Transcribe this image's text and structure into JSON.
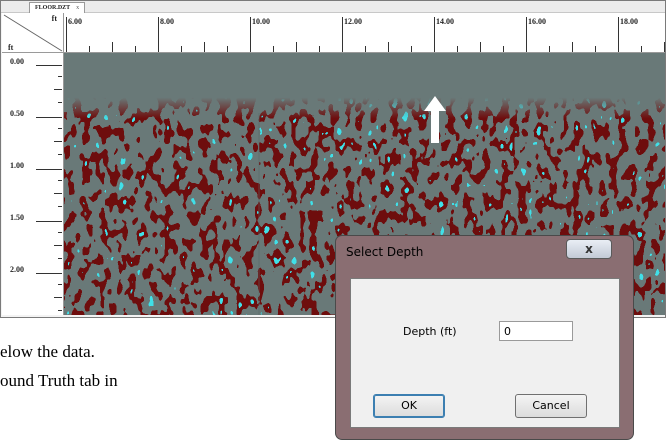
{
  "viewer": {
    "tab_label": "FLOOR.DZT",
    "tab_close_glyph": "x",
    "x_unit": "ft",
    "y_unit": "ft",
    "x_ticks": [
      "6.00",
      "8.00",
      "10.00",
      "12.00",
      "14.00",
      "16.00",
      "18.00"
    ],
    "y_ticks": [
      "0.00",
      "0.50",
      "1.00",
      "1.50",
      "2.00"
    ],
    "marker_icon": "up-arrow-icon"
  },
  "document": {
    "line1": "elow the data.",
    "line2": "ound Truth tab in"
  },
  "dialog": {
    "title": "Select Depth",
    "close_glyph": "x",
    "depth_label": "Depth  (ft)",
    "depth_value": "0",
    "ok_label": "OK",
    "cancel_label": "Cancel"
  },
  "colors": {
    "radar_background": "#697978",
    "radar_positive": "#40e0e8",
    "radar_negative": "#6e1010",
    "dialog_frame": "#8a6e72"
  }
}
